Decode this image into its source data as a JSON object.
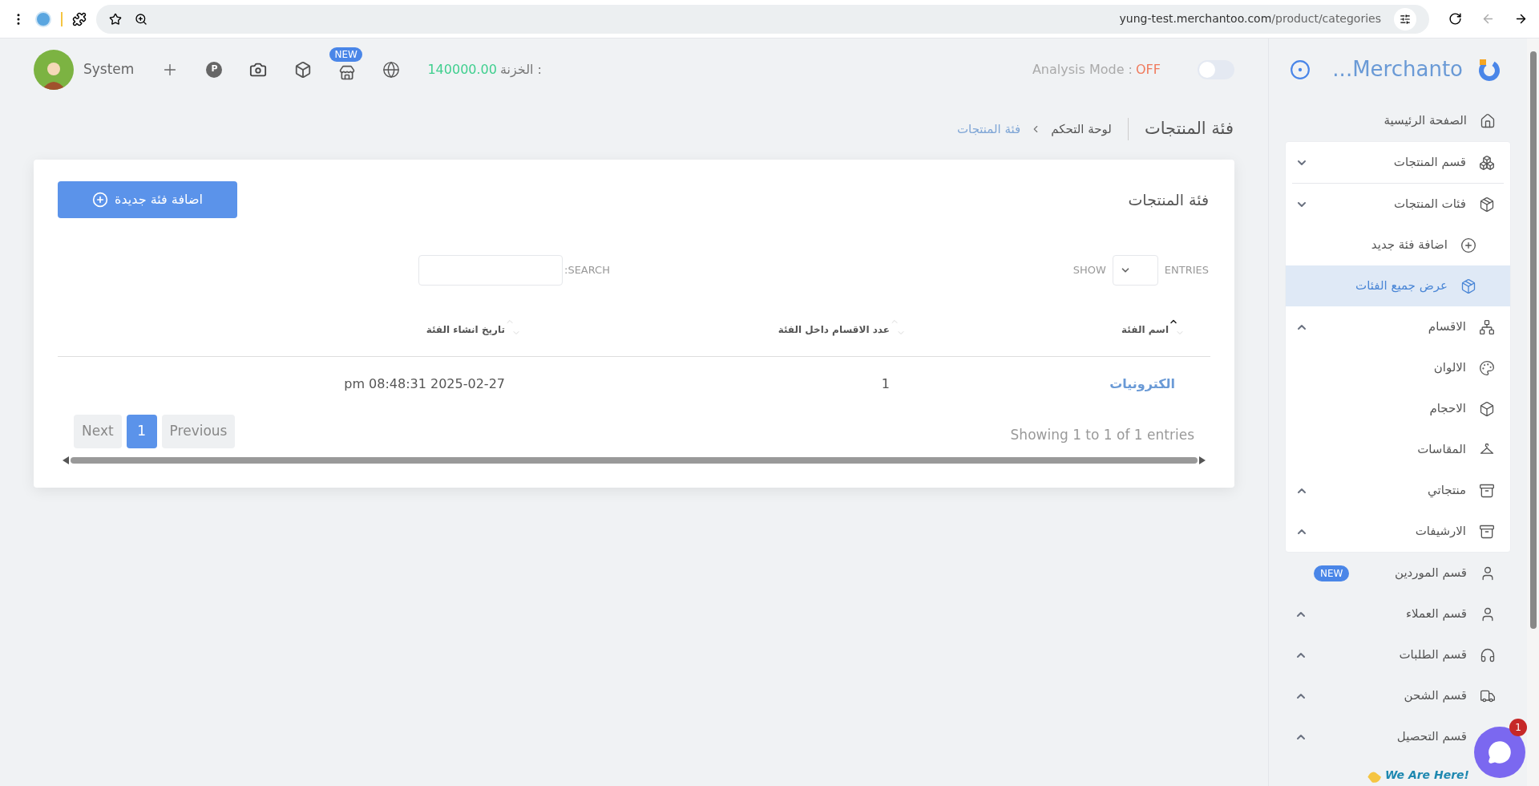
{
  "browser": {
    "url_host": "yung-test.merchantoo.com",
    "url_path": "/product/categories"
  },
  "header": {
    "user": "System",
    "parking_letter": "P",
    "new_badge": "NEW",
    "treasury_label": "الخزنة :",
    "treasury_value": "140000.00",
    "analysis_label": "Analysis Mode :",
    "analysis_value": "OFF",
    "analysis_on": false
  },
  "brand": {
    "name": "...Merchanto"
  },
  "page": {
    "title": "فئة المنتجات",
    "breadcrumbs": [
      {
        "label": "لوحة التحكم",
        "selected": false
      },
      {
        "label": "فئة المنتجات",
        "selected": true
      }
    ]
  },
  "card": {
    "title": "فئة المنتجات",
    "add_button": "اضافة فئة جديدة",
    "show_label": "SHOW",
    "entries_label": "ENTRIES",
    "search_label": ":SEARCH",
    "columns": [
      {
        "label": "اسم الفئة",
        "sorted": true
      },
      {
        "label": "عدد الاقسام داخل الفئة",
        "sorted": false
      },
      {
        "label": "تاريخ انشاء الفئة",
        "sorted": false
      }
    ],
    "rows": [
      {
        "name": "الكترونيات",
        "count": "1",
        "date": "pm 08:48:31 2025-02-27"
      }
    ],
    "info": "Showing 1 to 1 of 1 entries",
    "pagination": {
      "previous": "Previous",
      "next": "Next",
      "pages": [
        {
          "label": "1",
          "selected": true
        }
      ]
    }
  },
  "sidebar": {
    "items": [
      {
        "label": "الصفحة الرئيسية",
        "kind": "link"
      },
      {
        "label": "قسم المنتجات",
        "kind": "group",
        "expanded": true,
        "children": [
          {
            "label": "فئات المنتجات",
            "kind": "group",
            "expanded": true,
            "children": [
              {
                "label": "اضافة فئة جديد",
                "selected": false
              },
              {
                "label": "عرض جميع الفئات",
                "selected": true
              }
            ]
          },
          {
            "label": "الاقسام",
            "kind": "group",
            "expanded": false
          },
          {
            "label": "الالوان",
            "kind": "link"
          },
          {
            "label": "الاحجام",
            "kind": "link"
          },
          {
            "label": "المقاسات",
            "kind": "link"
          },
          {
            "label": "منتجاتي",
            "kind": "group",
            "expanded": false
          },
          {
            "label": "الارشيفات",
            "kind": "group",
            "expanded": false
          }
        ]
      },
      {
        "label": "قسم الموردين",
        "kind": "link",
        "badge": "NEW"
      },
      {
        "label": "قسم العملاء",
        "kind": "group",
        "expanded": false
      },
      {
        "label": "قسم الطلبات",
        "kind": "group",
        "expanded": false
      },
      {
        "label": "قسم الشحن",
        "kind": "group",
        "expanded": false
      },
      {
        "label": "قسم التحصيل",
        "kind": "group",
        "expanded": false
      }
    ]
  },
  "chat": {
    "tagline": "We Are Here!",
    "unread": "1"
  }
}
